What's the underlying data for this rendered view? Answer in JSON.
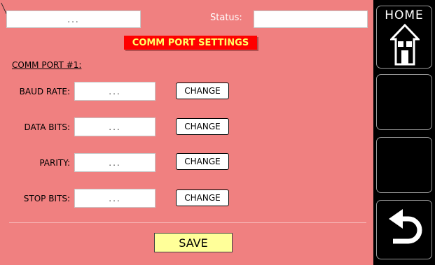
{
  "header": {
    "top_field_value": "...",
    "status_label": "Status:",
    "status_value": ""
  },
  "page_title": "COMM PORT SETTINGS",
  "section_label": "COMM PORT #1:",
  "settings": [
    {
      "label": "BAUD RATE:",
      "value": "...",
      "button": "CHANGE"
    },
    {
      "label": "DATA BITS:",
      "value": "...",
      "button": "CHANGE"
    },
    {
      "label": "PARITY:",
      "value": "...",
      "button": "CHANGE"
    },
    {
      "label": "STOP BITS:",
      "value": "...",
      "button": "CHANGE"
    }
  ],
  "save_label": "SAVE",
  "sidebar": {
    "home_label": "HOME",
    "home_icon": "home-icon",
    "back_icon": "back-arrow-icon"
  },
  "colors": {
    "panel_background": "#f08080",
    "title_background": "#ff0000",
    "title_text": "#ffff66",
    "save_button": "#ffff99",
    "sidebar_background": "#000000"
  }
}
